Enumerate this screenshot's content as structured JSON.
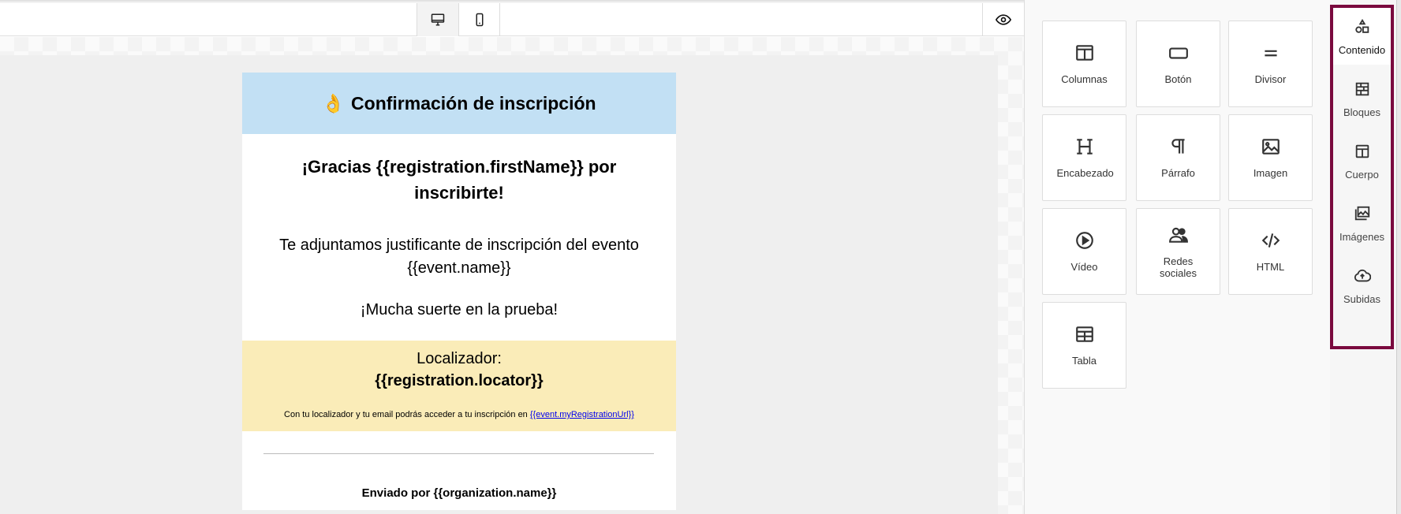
{
  "toolbar": {
    "desktop_icon": "desktop-icon",
    "mobile_icon": "mobile-icon",
    "preview_icon": "eye-icon"
  },
  "email": {
    "header_emoji": "👌",
    "header_title": "Confirmación de inscripción",
    "thanks_line": "¡Gracias {{registration.firstName}} por inscribirte!",
    "attach_line1": "Te adjuntamos justificante de inscripción del evento",
    "attach_line2": "{{event.name}}",
    "luck_line": "¡Mucha suerte en la prueba!",
    "locator_label": "Localizador:",
    "locator_value": "{{registration.locator}}",
    "access_text": "Con tu localizador y tu email podrás acceder a tu inscripción en ",
    "access_link": "{{event.myRegistrationUrl}}",
    "footer": "Enviado por {{organization.name}}",
    "colors": {
      "header_bg": "#c2e0f4",
      "locator_bg": "#faecb8",
      "link": "#0000ee"
    }
  },
  "tools": [
    {
      "label": "Columnas",
      "icon": "columns-icon"
    },
    {
      "label": "Botón",
      "icon": "button-icon"
    },
    {
      "label": "Divisor",
      "icon": "divider-icon"
    },
    {
      "label": "Encabezado",
      "icon": "heading-icon"
    },
    {
      "label": "Párrafo",
      "icon": "paragraph-icon"
    },
    {
      "label": "Imagen",
      "icon": "image-icon"
    },
    {
      "label": "Vídeo",
      "icon": "video-icon"
    },
    {
      "label": "Redes sociales",
      "icon": "social-icon"
    },
    {
      "label": "HTML",
      "icon": "code-icon"
    },
    {
      "label": "Tabla",
      "icon": "table-icon"
    }
  ],
  "sidebar": {
    "items": [
      {
        "label": "Contenido",
        "icon": "shapes-icon",
        "active": true
      },
      {
        "label": "Bloques",
        "icon": "blocks-icon"
      },
      {
        "label": "Cuerpo",
        "icon": "layout-icon"
      },
      {
        "label": "Imágenes",
        "icon": "images-icon"
      },
      {
        "label": "Subidas",
        "icon": "upload-cloud-icon"
      }
    ],
    "highlight_color": "#7a0a3e"
  }
}
